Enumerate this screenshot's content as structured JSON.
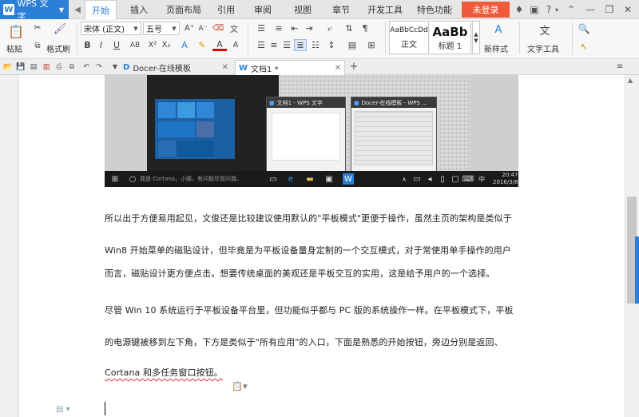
{
  "app": {
    "title": "WPS 文字"
  },
  "menu": {
    "tabs": [
      "开始",
      "插入",
      "页面布局",
      "引用",
      "审阅",
      "视图",
      "章节",
      "开发工具",
      "特色功能"
    ],
    "login": "未登录"
  },
  "ribbon": {
    "paste": "粘贴",
    "format_painter": "格式刷",
    "font_name": "宋体 (正文)",
    "font_size": "五号",
    "style_normal_preview": "AaBbCcDd",
    "style_normal": "正文",
    "style_h1_preview": "AaBb",
    "style_h1": "标题 1",
    "new_style": "新样式",
    "text_tools": "文字工具"
  },
  "tabs": {
    "doc1": "Docer-在线模板",
    "doc2": "文档1 *",
    "add": "+"
  },
  "screenshot": {
    "win1_title": "文档1 - WPS 文字",
    "win2_title": "Docer-在线模板 - WPS ...",
    "cortana": "我是 Cortana，小娜。有问题尽管问我。",
    "time": "20:47",
    "date": "2016/3/8",
    "ime": "中"
  },
  "document": {
    "lines": [
      "所以出于方便易用起见，文俊还是比较建议使用默认的\"平板模式\"更便于操作，虽然主页的架构是类似于",
      "Win8 开始菜单的磁贴设计，但毕竟是为平板设备量身定制的一个交互模式，对于常使用单手操作的用户",
      "而言，磁贴设计更方便点击。想要传统桌面的美观还是平板交互的实用，这是给予用户的一个选择。",
      "尽管 Win 10 系统运行于平板设备平台里，但功能似乎都与 PC 版的系统操作一样。在平板模式下，平板",
      "的电源键被移到左下角，下方是类似于\"所有应用\"的入口，下面是熟悉的开始按钮，旁边分别是返回、",
      "Cortana 和多任务窗口按钮。"
    ]
  },
  "colors": {
    "accent": "#2b7fd6",
    "login": "#f05a3a"
  }
}
